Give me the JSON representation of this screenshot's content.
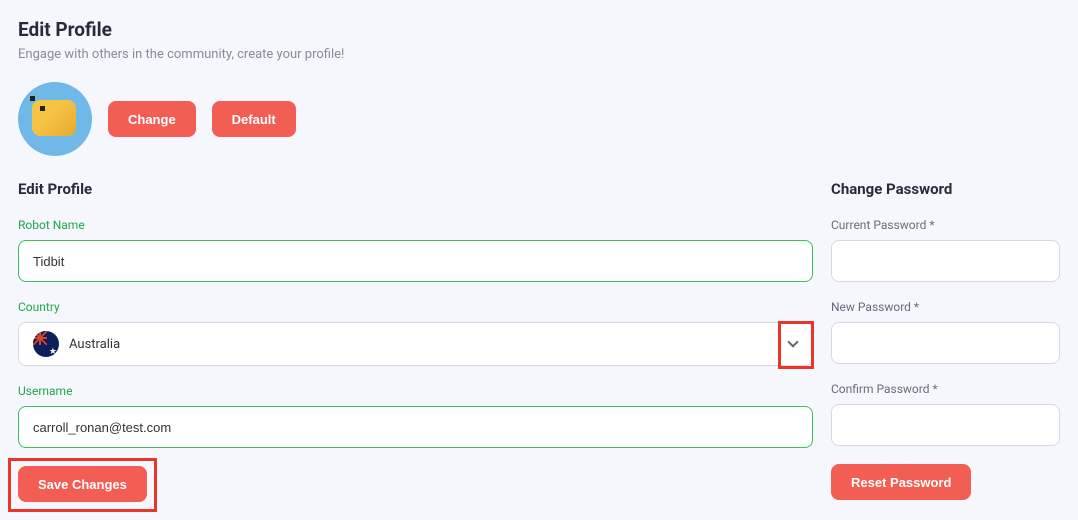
{
  "header": {
    "title": "Edit Profile",
    "subtitle": "Engage with others in the community, create your profile!"
  },
  "avatar_actions": {
    "change": "Change",
    "default": "Default"
  },
  "profile_section": {
    "title": "Edit Profile",
    "robot_name_label": "Robot Name",
    "robot_name_value": "Tidbit",
    "country_label": "Country",
    "country_value": "Australia",
    "username_label": "Username",
    "username_value": "carroll_ronan@test.com",
    "save_button": "Save Changes"
  },
  "password_section": {
    "title": "Change Password",
    "current_label": "Current Password *",
    "new_label": "New Password *",
    "confirm_label": "Confirm Password *",
    "reset_button": "Reset Password"
  }
}
